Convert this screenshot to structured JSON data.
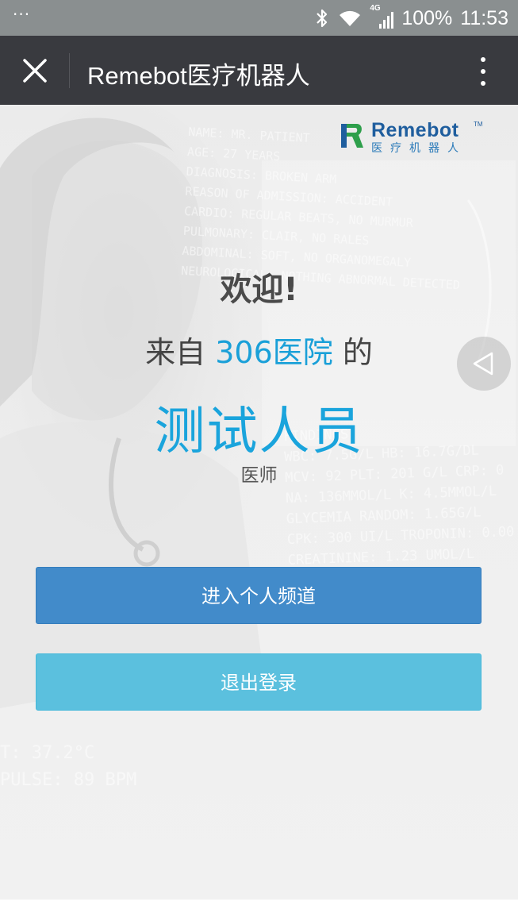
{
  "status_bar": {
    "more_glyph": "···",
    "network_label": "4G",
    "battery": "100%",
    "time": "11:53",
    "icons": [
      "bluetooth-icon",
      "wifi-icon",
      "signal-icon"
    ]
  },
  "app_bar": {
    "title": "Remebot医疗机器人",
    "close_icon": "close-icon",
    "more_icon": "more-vertical-icon"
  },
  "logo": {
    "name": "Remebot",
    "tm": "TM",
    "subtitle": "医疗机器人"
  },
  "background_text": {
    "notes": [
      "NAME: MR. PATIENT",
      "AGE: 27 YEARS",
      "DIAGNOSIS: BROKEN ARM",
      "REASON OF ADMISSION: ACCIDENT",
      "CARDIO: REGULAR BEATS, NO MURMUR",
      "PULMONARY: CLAIR, NO RALES",
      "ABDOMINAL: SOFT, NO ORGANOMEGALY",
      "NEUROLOGICAL: NOTHING ABNORMAL DETECTED"
    ],
    "labs": [
      "FINDINGS:",
      "WBC: 7.5G/L HB: 16.7G/DL",
      "MCV: 92 PLT: 201 G/L CRP: 0",
      "NA: 136MMOL/L K: 4.5MMOL/L",
      "GLYCEMIA RANDOM: 1.65G/L",
      "CPK: 300 UI/L TROPONIN: 0.00",
      "CREATININE: 1.23 UMOL/L"
    ],
    "pulse": [
      "T: 37.2°C",
      "PULSE: 89 BPM"
    ]
  },
  "welcome": {
    "greeting": "欢迎!",
    "from_prefix": "来自",
    "hospital": "306医院",
    "from_suffix": "的",
    "user_name": "测试人员",
    "role": "医师"
  },
  "buttons": {
    "enter_channel": "进入个人频道",
    "logout": "退出登录"
  },
  "colors": {
    "app_bar": "#393a3f",
    "status_bar": "#8a8f90",
    "accent_text": "#1aa4dc",
    "primary_button": "#428bca",
    "info_button": "#5bc0de"
  }
}
